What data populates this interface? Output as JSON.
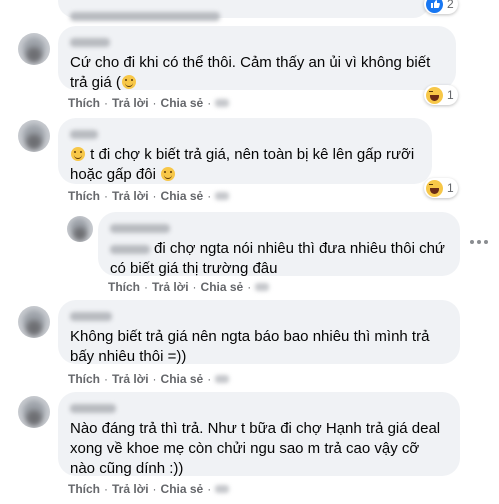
{
  "top": {
    "reaction_count": "2"
  },
  "actions": {
    "like": "Thích",
    "reply": "Trả lời",
    "share": "Chia sẻ",
    "separator": "·"
  },
  "comments": [
    {
      "text": "Cứ cho đi khi có thể thôi. Cảm thấy an ủi vì không biết trả giá (",
      "reaction_count": "1"
    },
    {
      "text": " t đi chợ k biết trả giá, nên toàn bị kê lên gấp rưỡi hoặc gấp đôi",
      "reaction_count": "1"
    },
    {
      "text": "đi chợ ngta nói nhiêu thì đưa nhiêu thôi chứ có biết giá thị trường đâu"
    },
    {
      "text": "Không biết trả giá nên ngta báo bao nhiêu thì mình trả bấy nhiêu thôi =))"
    },
    {
      "text": "Nào đáng trả thì trả. Như t bữa đi chợ Hạnh trả giá deal xong về khoe mẹ còn chửi ngu sao m trả cao vậy cỡ nào cũng dính :))"
    }
  ],
  "colors": {
    "bubble": "#f0f2f5",
    "action_text": "#65676b",
    "like_blue": "#1877f2",
    "emoji_yellow": "#f7c748"
  },
  "icons": [
    "like-icon",
    "haha-icon",
    "smile-emoji",
    "more-options-icon"
  ]
}
